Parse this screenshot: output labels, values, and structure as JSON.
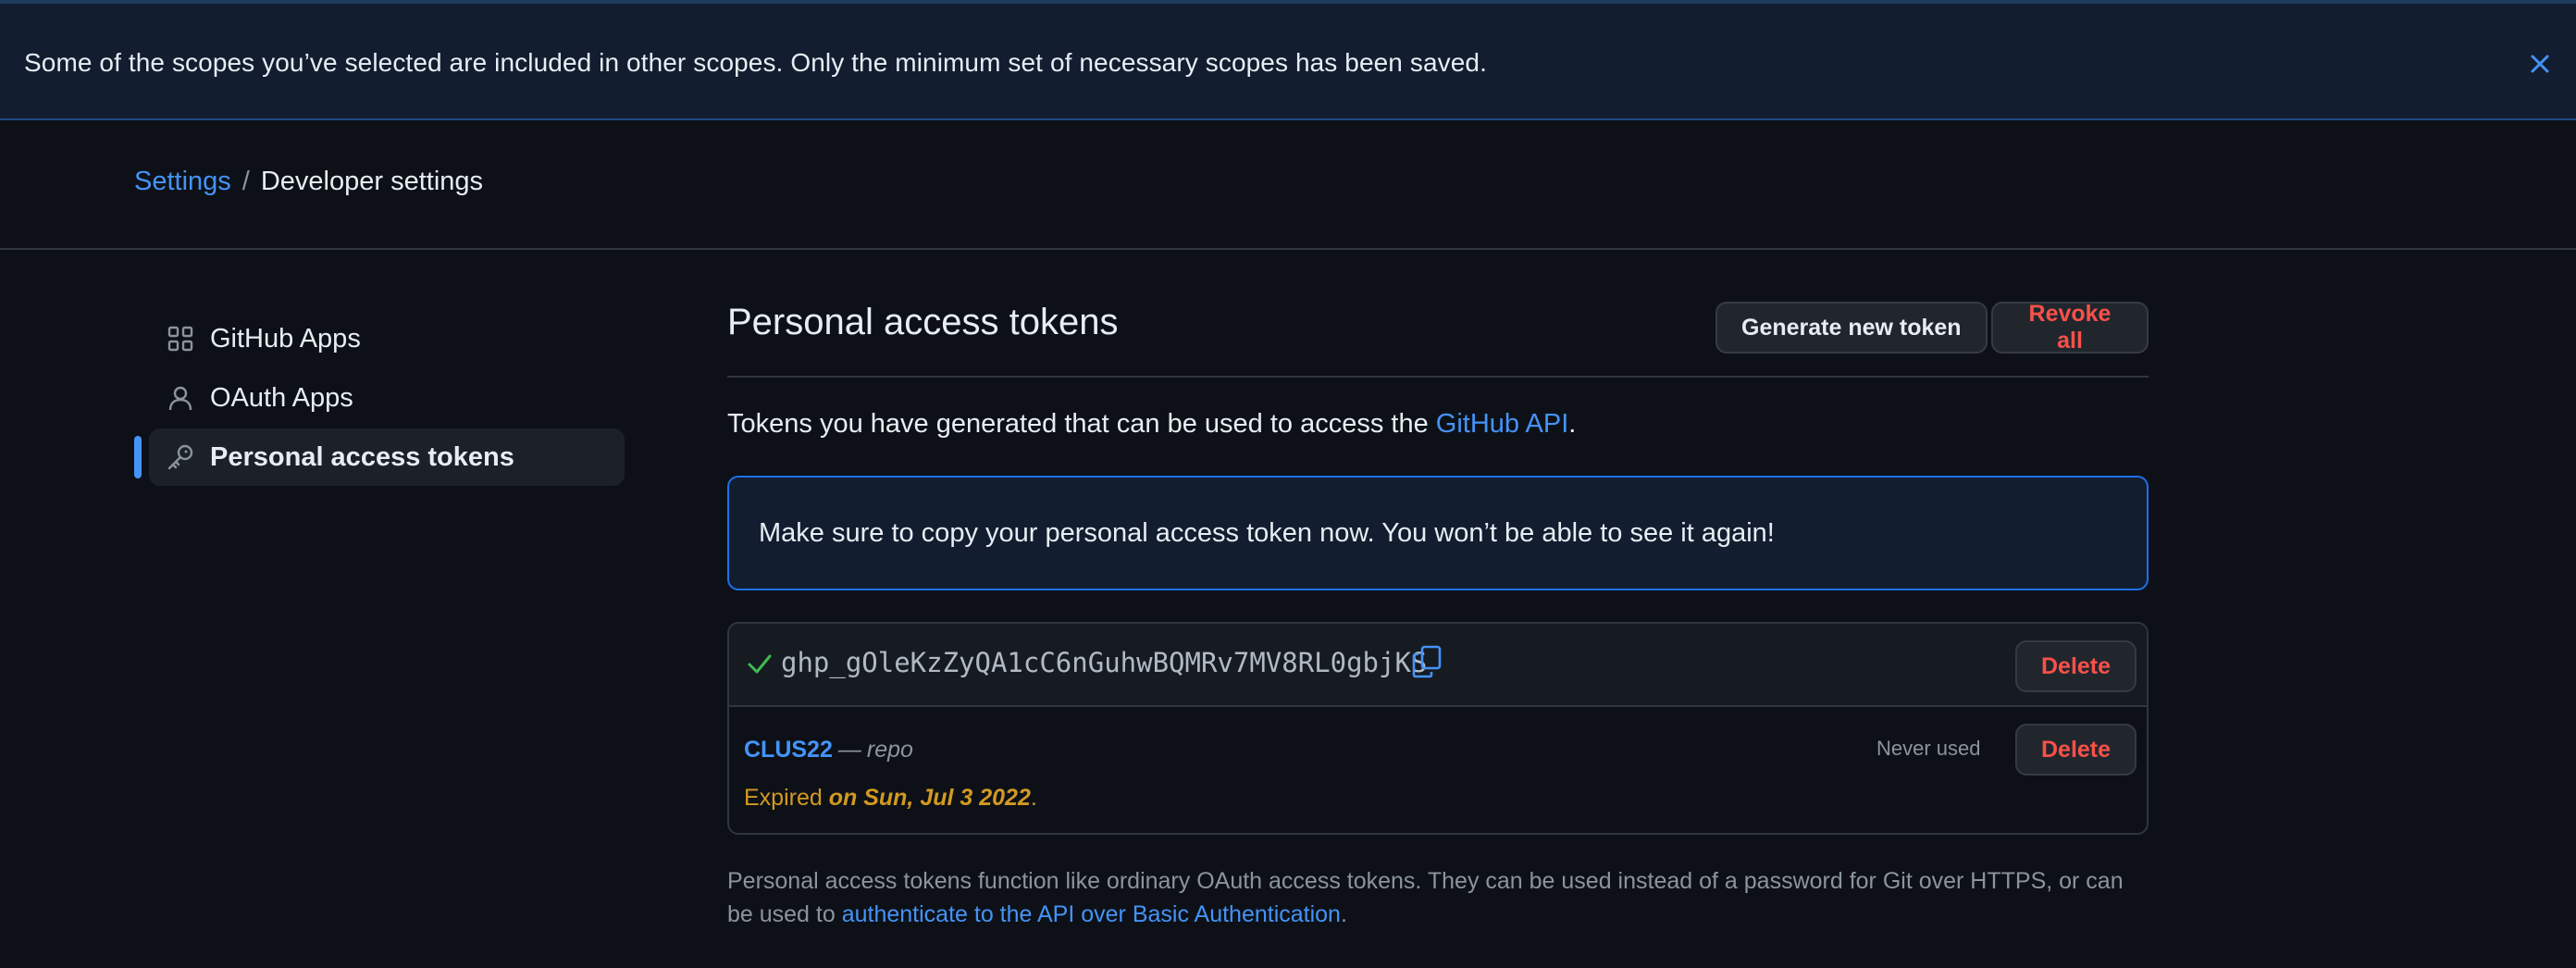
{
  "flash": {
    "message": "Some of the scopes you’ve selected are included in other scopes. Only the minimum set of necessary scopes has been saved."
  },
  "breadcrumb": {
    "parent": "Settings",
    "separator": "/",
    "current": "Developer settings"
  },
  "sidebar": {
    "items": [
      {
        "label": "GitHub Apps",
        "icon": "apps-grid-icon"
      },
      {
        "label": "OAuth Apps",
        "icon": "person-icon"
      },
      {
        "label": "Personal access tokens",
        "icon": "key-icon",
        "active": true
      }
    ]
  },
  "main": {
    "title": "Personal access tokens",
    "generate_label": "Generate new token",
    "revoke_label": "Revoke all",
    "desc_prefix": "Tokens you have generated that can be used to access the ",
    "desc_link": "GitHub API",
    "desc_suffix": ".",
    "notice": "Make sure to copy your personal access token now. You won’t be able to see it again!"
  },
  "new_token": {
    "value": "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",
    "delete_label": "Delete"
  },
  "token": {
    "name": "CLUS22",
    "dash": "—",
    "scope": "repo",
    "expired_prefix": "Expired ",
    "expired_date": "on Sun, Jul 3 2022",
    "expired_suffix": ".",
    "usage": "Never used",
    "delete_label": "Delete"
  },
  "footer": {
    "text": "Personal access tokens function like ordinary OAuth access tokens. They can be used instead of a password for Git over HTTPS, or can be used to ",
    "link": "authenticate to the API over Basic Authentication",
    "suffix": "."
  },
  "colors": {
    "background": "#0d1117",
    "accent": "#4493f8",
    "danger": "#f85149",
    "success": "#3fb950",
    "warning": "#d29922"
  }
}
